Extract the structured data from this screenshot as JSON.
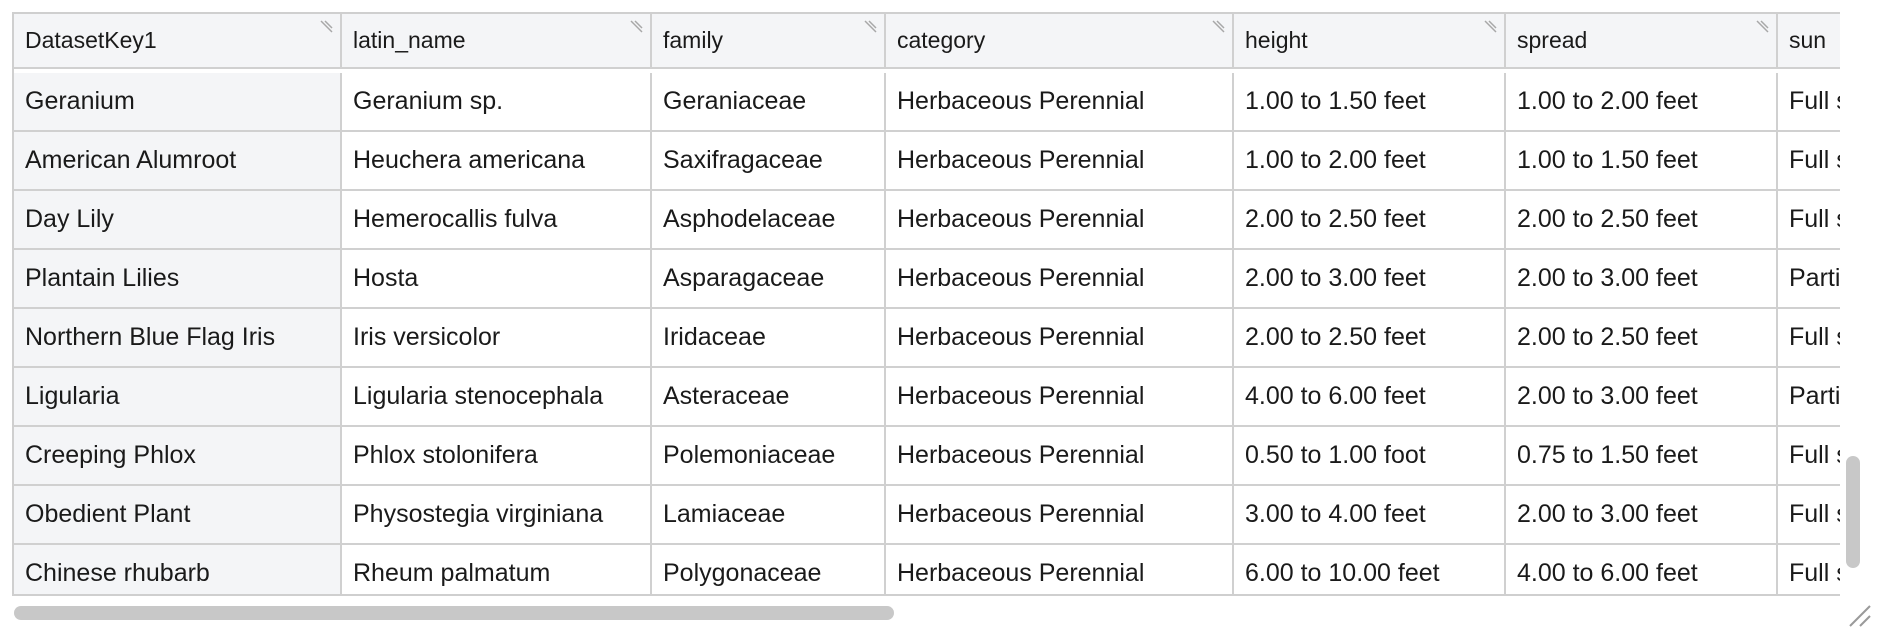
{
  "table": {
    "columns": [
      "DatasetKey1",
      "latin_name",
      "family",
      "category",
      "height",
      "spread",
      "sun"
    ],
    "rows": [
      [
        "Geranium",
        "Geranium sp.",
        "Geraniaceae",
        "Herbaceous Perennial",
        "1.00 to 1.50 feet",
        "1.00 to 2.00 feet",
        "Full s"
      ],
      [
        "American Alumroot",
        "Heuchera americana",
        "Saxifragaceae",
        "Herbaceous Perennial",
        "1.00 to 2.00 feet",
        "1.00 to 1.50 feet",
        "Full s"
      ],
      [
        "Day Lily",
        "Hemerocallis fulva",
        "Asphodelaceae",
        "Herbaceous Perennial",
        "2.00 to 2.50 feet",
        "2.00 to 2.50 feet",
        "Full s"
      ],
      [
        "Plantain Lilies",
        "Hosta",
        "Asparagaceae",
        "Herbaceous Perennial",
        "2.00 to 3.00 feet",
        "2.00 to 3.00 feet",
        "Parti"
      ],
      [
        "Northern Blue Flag Iris",
        "Iris versicolor",
        "Iridaceae",
        "Herbaceous Perennial",
        "2.00 to 2.50 feet",
        "2.00 to 2.50 feet",
        "Full s"
      ],
      [
        "Ligularia",
        "Ligularia stenocephala",
        "Asteraceae",
        "Herbaceous Perennial",
        "4.00 to 6.00 feet",
        "2.00 to 3.00 feet",
        "Parti"
      ],
      [
        "Creeping Phlox",
        "Phlox stolonifera",
        "Polemoniaceae",
        "Herbaceous Perennial",
        "0.50 to 1.00 foot",
        "0.75 to 1.50 feet",
        "Full s"
      ],
      [
        "Obedient Plant",
        "Physostegia virginiana",
        "Lamiaceae",
        "Herbaceous Perennial",
        "3.00 to 4.00 feet",
        "2.00 to 3.00 feet",
        "Full s"
      ],
      [
        "Chinese rhubarb",
        "Rheum palmatum",
        "Polygonaceae",
        "Herbaceous Perennial",
        "6.00 to 10.00 feet",
        "4.00 to 6.00 feet",
        "Full s"
      ]
    ]
  },
  "icons": {
    "column_resize": "column-resize-grip-icon",
    "panel_resize": "panel-resize-grip-icon"
  },
  "colors": {
    "header_bg": "#f4f5f7",
    "grid_line": "#d0d0d0",
    "scroll_thumb": "#c8c8c8"
  }
}
